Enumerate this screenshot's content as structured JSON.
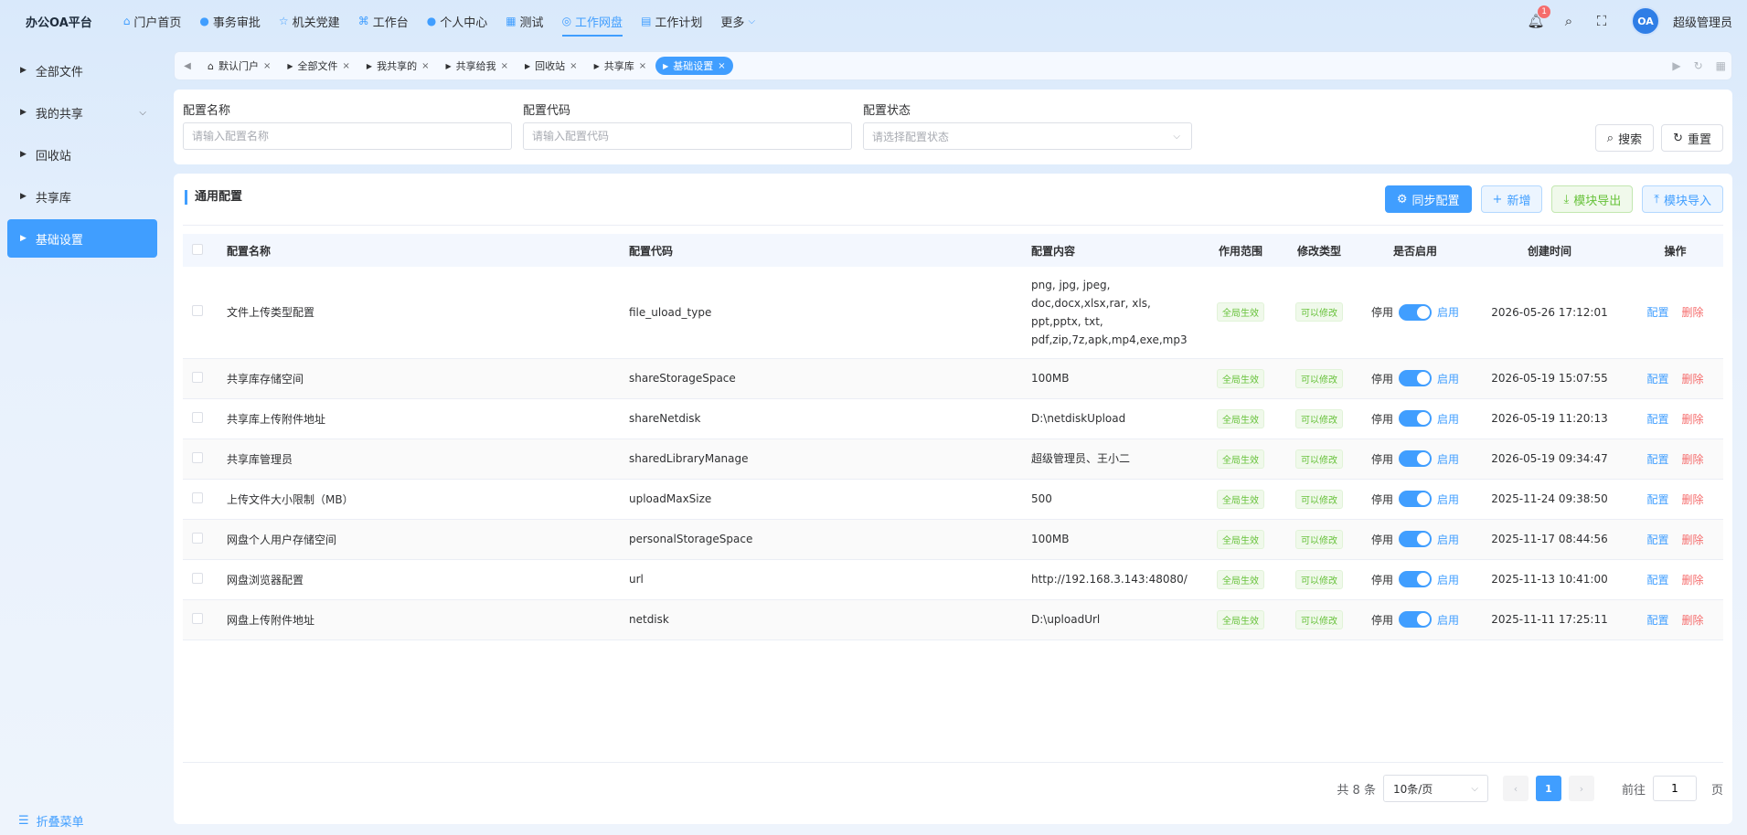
{
  "brand": "办公OA平台",
  "nav": [
    {
      "label": "门户首页",
      "icon": "home-icon",
      "glyph": "⌂"
    },
    {
      "label": "事务审批",
      "icon": "info-icon",
      "glyph": "●"
    },
    {
      "label": "机关党建",
      "icon": "star-icon",
      "glyph": "☆"
    },
    {
      "label": "工作台",
      "icon": "sitemap-icon",
      "glyph": "⌘"
    },
    {
      "label": "个人中心",
      "icon": "user-icon",
      "glyph": "●"
    },
    {
      "label": "测试",
      "icon": "grid-icon",
      "glyph": "▦"
    },
    {
      "label": "工作网盘",
      "icon": "database-icon",
      "glyph": "◎"
    },
    {
      "label": "工作计划",
      "icon": "calendar-icon",
      "glyph": "▤"
    }
  ],
  "nav_more": "更多",
  "notification_count": "1",
  "avatar_text": "OA",
  "username": "超级管理员",
  "sidebar": [
    {
      "label": "全部文件"
    },
    {
      "label": "我的共享"
    },
    {
      "label": "回收站"
    },
    {
      "label": "共享库"
    },
    {
      "label": "基础设置"
    }
  ],
  "collapse_label": "折叠菜单",
  "tabs": [
    {
      "label": "默认门户"
    },
    {
      "label": "全部文件"
    },
    {
      "label": "我共享的"
    },
    {
      "label": "共享给我"
    },
    {
      "label": "回收站"
    },
    {
      "label": "共享库"
    },
    {
      "label": "基础设置"
    }
  ],
  "filter": {
    "name_label": "配置名称",
    "name_placeholder": "请输入配置名称",
    "code_label": "配置代码",
    "code_placeholder": "请输入配置代码",
    "status_label": "配置状态",
    "status_placeholder": "请选择配置状态",
    "search": "搜索",
    "reset": "重置"
  },
  "section_title": "通用配置",
  "actions": {
    "sync": "同步配置",
    "add": "新增",
    "export": "模块导出",
    "import": "模块导入"
  },
  "columns": [
    "配置名称",
    "配置代码",
    "配置内容",
    "作用范围",
    "修改类型",
    "是否启用",
    "创建时间",
    "操作"
  ],
  "rows": [
    {
      "name": "文件上传类型配置",
      "code": "file_uload_type",
      "content": [
        "png, jpg, jpeg,",
        "doc,docx,xlsx,rar, xls,",
        "ppt,pptx, txt,",
        "pdf,zip,7z,apk,mp4,exe,mp3"
      ],
      "scope": "全局生效",
      "modify": "可以修改",
      "off": "停用",
      "on": "启用",
      "created": "2026-05-26 17:12:01",
      "edit": "配置",
      "del": "删除"
    },
    {
      "name": "共享库存储空间",
      "code": "shareStorageSpace",
      "content": [
        "100MB"
      ],
      "scope": "全局生效",
      "modify": "可以修改",
      "off": "停用",
      "on": "启用",
      "created": "2026-05-19 15:07:55",
      "edit": "配置",
      "del": "删除"
    },
    {
      "name": "共享库上传附件地址",
      "code": "shareNetdisk",
      "content": [
        "D:\\netdiskUpload"
      ],
      "scope": "全局生效",
      "modify": "可以修改",
      "off": "停用",
      "on": "启用",
      "created": "2026-05-19 11:20:13",
      "edit": "配置",
      "del": "删除"
    },
    {
      "name": "共享库管理员",
      "code": "sharedLibraryManage",
      "content": [
        "超级管理员、王小二"
      ],
      "scope": "全局生效",
      "modify": "可以修改",
      "off": "停用",
      "on": "启用",
      "created": "2026-05-19 09:34:47",
      "edit": "配置",
      "del": "删除"
    },
    {
      "name": "上传文件大小限制（MB）",
      "code": "uploadMaxSize",
      "content": [
        "500"
      ],
      "scope": "全局生效",
      "modify": "可以修改",
      "off": "停用",
      "on": "启用",
      "created": "2025-11-24 09:38:50",
      "edit": "配置",
      "del": "删除"
    },
    {
      "name": "网盘个人用户存储空间",
      "code": "personalStorageSpace",
      "content": [
        "100MB"
      ],
      "scope": "全局生效",
      "modify": "可以修改",
      "off": "停用",
      "on": "启用",
      "created": "2025-11-17 08:44:56",
      "edit": "配置",
      "del": "删除"
    },
    {
      "name": "网盘浏览器配置",
      "code": "url",
      "content": [
        "http://192.168.3.143:48080/"
      ],
      "scope": "全局生效",
      "modify": "可以修改",
      "off": "停用",
      "on": "启用",
      "created": "2025-11-13 10:41:00",
      "edit": "配置",
      "del": "删除"
    },
    {
      "name": "网盘上传附件地址",
      "code": "netdisk",
      "content": [
        "D:\\uploadUrl"
      ],
      "scope": "全局生效",
      "modify": "可以修改",
      "off": "停用",
      "on": "启用",
      "created": "2025-11-11 17:25:11",
      "edit": "配置",
      "del": "删除"
    }
  ],
  "pagination": {
    "total": "共 8 条",
    "page_size": "10条/页",
    "current": "1",
    "goto_label": "前往",
    "goto_value": "1",
    "page_suffix": "页"
  }
}
